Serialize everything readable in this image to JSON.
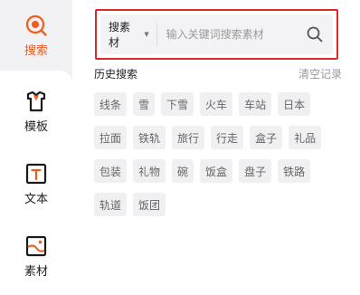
{
  "nav": {
    "items": [
      {
        "label": "搜索",
        "icon": "search-icon",
        "active": true
      },
      {
        "label": "模板",
        "icon": "shirt-icon",
        "active": false
      },
      {
        "label": "文本",
        "icon": "text-icon",
        "active": false
      },
      {
        "label": "素材",
        "icon": "image-icon",
        "active": false
      }
    ]
  },
  "search": {
    "scope_label": "搜素材",
    "placeholder": "输入关键词搜索素材",
    "value": ""
  },
  "history": {
    "title": "历史搜索",
    "clear_label": "清空记录",
    "tags": [
      "线条",
      "雪",
      "下雪",
      "火车",
      "车站",
      "日本",
      "拉面",
      "铁轨",
      "旅行",
      "行走",
      "盒子",
      "礼品",
      "包装",
      "礼物",
      "碗",
      "饭盒",
      "盘子",
      "铁路",
      "轨道",
      "饭团"
    ]
  },
  "colors": {
    "accent": "#f25a1e",
    "highlight_border": "#e0282b",
    "tag_bg": "#f0f0f2"
  }
}
